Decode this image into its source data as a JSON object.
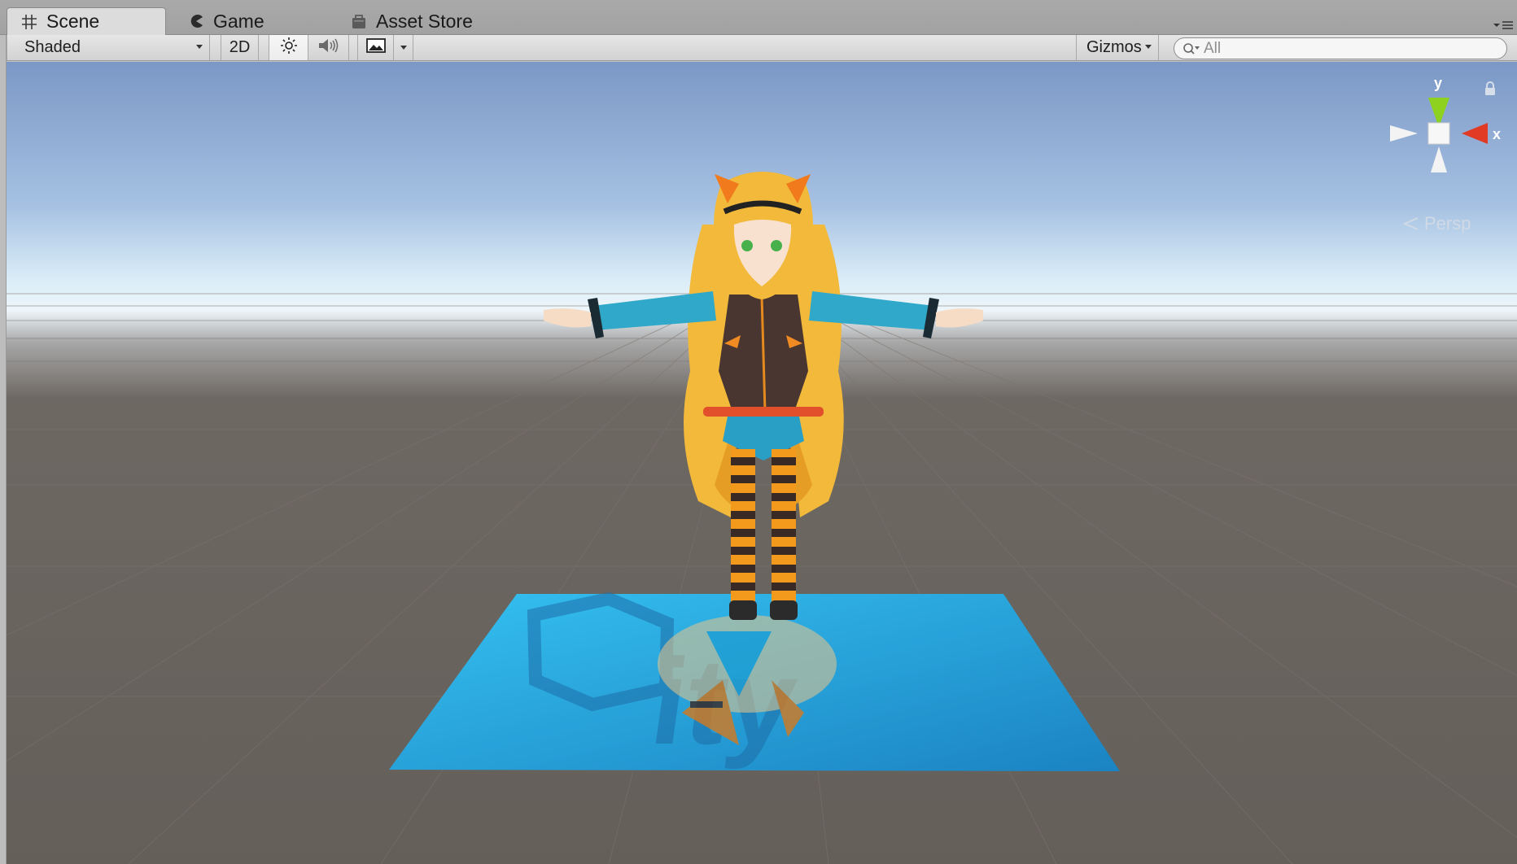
{
  "tabs": [
    {
      "label": "Scene",
      "icon": "hash-grid-icon",
      "active": true
    },
    {
      "label": "Game",
      "icon": "pacman-icon",
      "active": false
    },
    {
      "label": "Asset Store",
      "icon": "shopping-bag-icon",
      "active": false
    }
  ],
  "toolbar": {
    "draw_mode": "Shaded",
    "mode_2d": "2D",
    "lighting_icon": "sun-icon",
    "audio_icon": "speaker-icon",
    "effects_icon": "image-icon",
    "gizmos_label": "Gizmos",
    "search_placeholder": "All"
  },
  "scene_gizmo": {
    "axis_y": "y",
    "axis_x": "x",
    "projection": "Persp",
    "colors": {
      "y": "#8fd11f",
      "x": "#e23b25",
      "neutral": "#ffffff"
    }
  },
  "scene": {
    "sky_top": "#7b98c6",
    "horizon": "#eef6fa",
    "ground": "#655f5a",
    "plane_color": "#2aa7df",
    "plane_text": "unity"
  }
}
